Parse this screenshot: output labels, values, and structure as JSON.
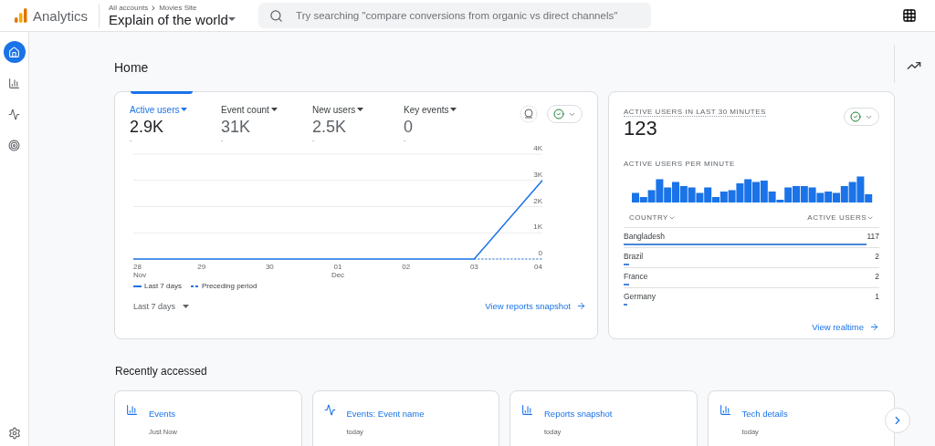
{
  "header": {
    "product": "Analytics",
    "breadcrumb": [
      "All accounts",
      "Movies Site"
    ],
    "property": "Explain of the world",
    "search": {
      "placeholder": "Try searching \"compare conversions from organic vs direct channels\""
    }
  },
  "sidebar": {
    "items": [
      {
        "kind": "home",
        "selected": true
      },
      {
        "kind": "reports",
        "selected": false
      },
      {
        "kind": "explore",
        "selected": false
      },
      {
        "kind": "advertising",
        "selected": false
      }
    ]
  },
  "page": {
    "title": "Home"
  },
  "overview": {
    "metrics": [
      {
        "label": "Active users",
        "value": "2.9K",
        "change": "-",
        "selected": true
      },
      {
        "label": "Event count",
        "value": "31K",
        "change": "-",
        "selected": false
      },
      {
        "label": "New users",
        "value": "2.5K",
        "change": "-",
        "selected": false
      },
      {
        "label": "Key events",
        "value": "0",
        "change": "-",
        "selected": false
      }
    ],
    "chart_data": {
      "type": "line",
      "grid": true,
      "categories": [
        {
          "day": "28",
          "month": "Nov"
        },
        {
          "day": "29"
        },
        {
          "day": "30"
        },
        {
          "day": "01",
          "month": "Dec"
        },
        {
          "day": "02"
        },
        {
          "day": "03"
        },
        {
          "day": "04"
        }
      ],
      "ylim": [
        0,
        4000
      ],
      "yticks": [
        {
          "value": 0,
          "label": "0"
        },
        {
          "value": 1000,
          "label": "1K"
        },
        {
          "value": 2000,
          "label": "2K"
        },
        {
          "value": 3000,
          "label": "3K"
        },
        {
          "value": 4000,
          "label": "4K"
        }
      ],
      "series": [
        {
          "name": "Last 7 days",
          "color": "#1a73e8",
          "line_style": "solid",
          "values": [
            0,
            0,
            0,
            0,
            0,
            0,
            3000
          ]
        },
        {
          "name": "Preceding period",
          "color": "#1a73e8",
          "line_style": "dashed",
          "values": [
            null,
            null,
            null,
            null,
            null,
            0,
            0
          ]
        }
      ]
    },
    "date_range": "Last 7 days",
    "link": "View reports snapshot"
  },
  "realtime": {
    "title": "ACTIVE USERS IN LAST 30 MINUTES",
    "value": "123",
    "per_minute_label": "ACTIVE USERS PER MINUTE",
    "columns": [
      "COUNTRY",
      "ACTIVE USERS"
    ],
    "rows": [
      {
        "country": "Bangladesh",
        "users": "117",
        "level": 0.95
      },
      {
        "country": "Brazil",
        "users": "2",
        "level": 0.02
      },
      {
        "country": "France",
        "users": "2",
        "level": 0.02
      },
      {
        "country": "Germany",
        "users": "1",
        "level": 0.01
      }
    ],
    "link": "View realtime"
  },
  "recent": {
    "title": "Recently accessed",
    "items": [
      {
        "kind": "report",
        "title": "Events",
        "time": "Just Now"
      },
      {
        "kind": "explore",
        "title": "Events: Event name",
        "time": "today"
      },
      {
        "kind": "report",
        "title": "Reports snapshot",
        "time": "today"
      },
      {
        "kind": "report",
        "title": "Tech details",
        "time": "today"
      }
    ]
  }
}
